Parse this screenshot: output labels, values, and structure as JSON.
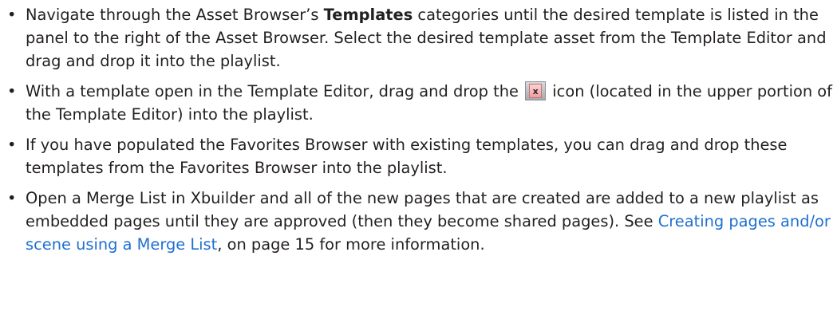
{
  "bullets": [
    {
      "a": "Navigate through the Asset Browser’s ",
      "b": "Templates",
      "c": " categories until the desired template is listed in the panel to the right of the Asset Browser. Select the desired template asset from the Template Editor and drag and drop it into the playlist."
    },
    {
      "a": "With a template open in the Template Editor, drag and drop the ",
      "icon_glyph": "x",
      "icon_name": "template-drag-icon",
      "c": " icon (located in the upper portion of the Template Editor) into the playlist."
    },
    {
      "a": "If you have populated the Favorites Browser with existing templates, you can drag and drop these templates from the Favorites Browser into the playlist."
    },
    {
      "a": "Open a Merge List in Xbuilder and all of the new pages that are created are added to a new playlist as embedded pages until they are approved (then they become shared pages). See ",
      "link": "Creating pages and/or scene using a Merge List",
      "c": ", on page 15 for more information."
    }
  ],
  "colors": {
    "text": "#231f20",
    "link": "#1f6fd0"
  }
}
